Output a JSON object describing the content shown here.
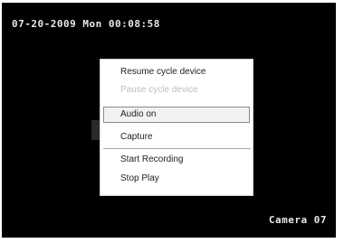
{
  "osd": {
    "timestamp": "07-20-2009 Mon 00:08:58",
    "camera_label": "Camera 07"
  },
  "context_menu": {
    "items": [
      {
        "label": "Resume cycle device",
        "enabled": true
      },
      {
        "label": "Pause cycle device",
        "enabled": false
      },
      {
        "label": "Audio on",
        "enabled": true,
        "highlighted": true
      },
      {
        "label": "Capture",
        "enabled": true
      },
      {
        "label": "Start Recording",
        "enabled": true
      },
      {
        "label": "Stop Play",
        "enabled": true
      }
    ]
  },
  "colors": {
    "video_background": "#000000",
    "osd_text": "#e8e8e8",
    "menu_background": "#ffffff",
    "disabled_text": "#bdbdbd"
  }
}
